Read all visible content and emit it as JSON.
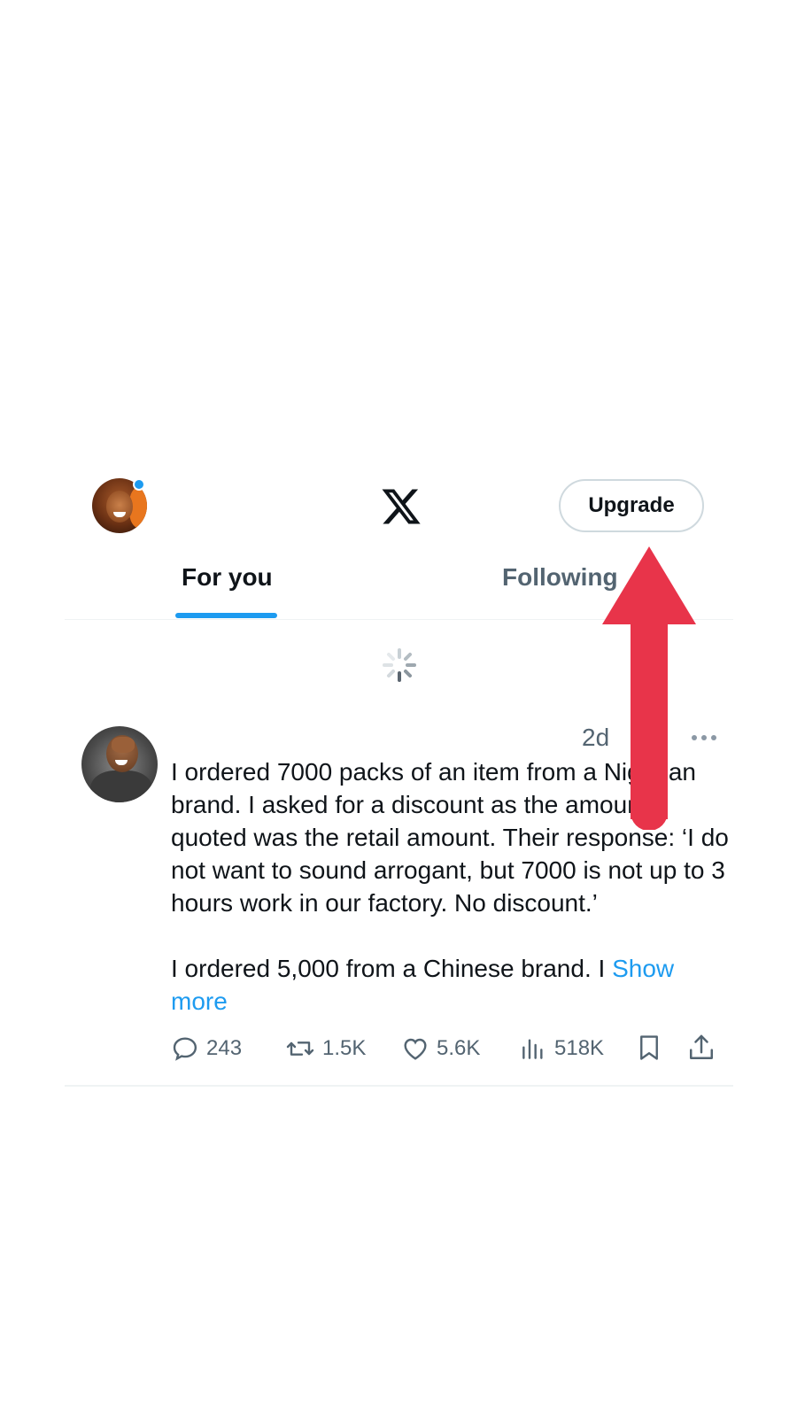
{
  "header": {
    "upgrade_label": "Upgrade",
    "logo_icon": "x-logo-icon",
    "notification_dot_color": "#1d9bf0"
  },
  "tabs": [
    {
      "label": "For you",
      "active": true
    },
    {
      "label": "Following",
      "active": false
    }
  ],
  "colors": {
    "accent": "#1d9bf0",
    "text_primary": "#0f1419",
    "text_secondary": "#536471",
    "annotation_arrow": "#e8344a"
  },
  "tweet": {
    "time": "2d",
    "text_line_1": "I ordered 7000 packs of an item from a Nigerian brand. I asked for a discount as the amount quoted was the retail amount. Their response: ‘I do not want to sound arrogant, but 7000 is not up to 3 hours work in our factory. No discount.’",
    "text_line_2": "I ordered 5,000 from a Chinese brand. I",
    "show_more": "Show more",
    "replies": "243",
    "retweets": "1.5K",
    "likes": "5.6K",
    "views": "518K"
  },
  "icons": [
    "avatar",
    "x-logo-icon",
    "loading-spinner-icon",
    "more-options-icon",
    "reply-icon",
    "retweet-icon",
    "like-icon",
    "views-icon",
    "bookmark-icon",
    "share-icon",
    "red-arrow-annotation"
  ]
}
